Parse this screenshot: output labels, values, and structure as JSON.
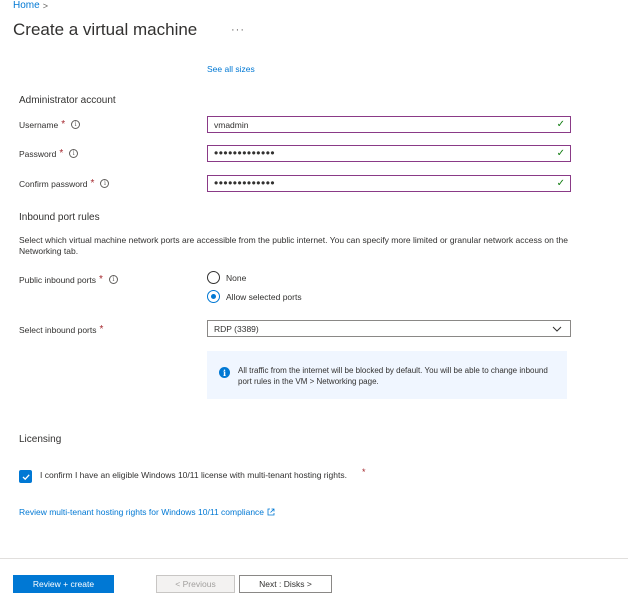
{
  "breadcrumb": {
    "home": "Home",
    "separator": ">"
  },
  "page": {
    "title": "Create a virtual machine",
    "more": "···"
  },
  "size": {
    "see_all_link": "See all sizes"
  },
  "admin": {
    "section_title": "Administrator account",
    "username": {
      "label": "Username",
      "value": "vmadmin"
    },
    "password": {
      "label": "Password",
      "mask": "•••••••••••••"
    },
    "confirm_password": {
      "label": "Confirm password",
      "mask": "•••••••••••••"
    },
    "required_mark": "*"
  },
  "inbound": {
    "section_title": "Inbound port rules",
    "description": "Select which virtual machine network ports are accessible from the public internet. You can specify more limited or granular network access on the Networking tab.",
    "public_ports_label": "Public inbound ports",
    "options": [
      {
        "label": "None",
        "selected": false
      },
      {
        "label": "Allow selected ports",
        "selected": true
      }
    ],
    "select_ports_label": "Select inbound ports",
    "select_ports_value": "RDP (3389)",
    "info_text": "All traffic from the internet will be blocked by default. You will be able to change inbound port rules in the VM > Networking page."
  },
  "licensing": {
    "section_title": "Licensing",
    "confirm_text": "I confirm I have an eligible Windows 10/11 license with multi-tenant hosting rights.",
    "checked": true,
    "review_link": "Review multi-tenant hosting rights for Windows 10/11 compliance"
  },
  "footer": {
    "review_create": "Review + create",
    "previous": "< Previous",
    "next": "Next : Disks >"
  },
  "colors": {
    "accent": "#0078d4",
    "valid_border": "#8a3a87",
    "required": "#a4262c",
    "success": "#107c10",
    "info_bg": "#f0f6ff"
  }
}
